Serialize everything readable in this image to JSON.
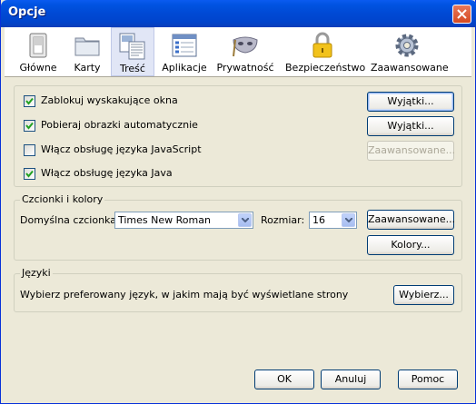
{
  "window": {
    "title": "Opcje"
  },
  "panes": [
    {
      "label": "Główne",
      "icon": "switch-icon"
    },
    {
      "label": "Karty",
      "icon": "tabs-folder-icon"
    },
    {
      "label": "Treść",
      "icon": "content-icon",
      "selected": true
    },
    {
      "label": "Aplikacje",
      "icon": "applications-icon"
    },
    {
      "label": "Prywatność",
      "icon": "privacy-mask-icon"
    },
    {
      "label": "Bezpieczeństwo",
      "icon": "security-padlock-icon"
    },
    {
      "label": "Zaawansowane",
      "icon": "advanced-gear-icon"
    }
  ],
  "content": {
    "block_popups": {
      "label": "Zablokuj wyskakujące okna",
      "checked": true,
      "button": "Wyjątki..."
    },
    "load_images": {
      "label": "Pobieraj obrazki automatycznie",
      "checked": true,
      "button": "Wyjątki..."
    },
    "enable_js": {
      "label": "Włącz obsługę języka JavaScript",
      "checked": false,
      "button": "Zaawansowane..."
    },
    "enable_java": {
      "label": "Włącz obsługę języka Java",
      "checked": true
    }
  },
  "fonts": {
    "group_title": "Czcionki i kolory",
    "default_font_label": "Domyślna czcionka:",
    "default_font_value": "Times New Roman",
    "size_label": "Rozmiar:",
    "size_value": "16",
    "advanced_button": "Zaawansowane...",
    "colors_button": "Kolory..."
  },
  "languages": {
    "group_title": "Języki",
    "description": "Wybierz preferowany język, w jakim mają być wyświetlane strony",
    "choose_button": "Wybierz..."
  },
  "footer": {
    "ok": "OK",
    "cancel": "Anuluj",
    "help": "Pomoc"
  }
}
